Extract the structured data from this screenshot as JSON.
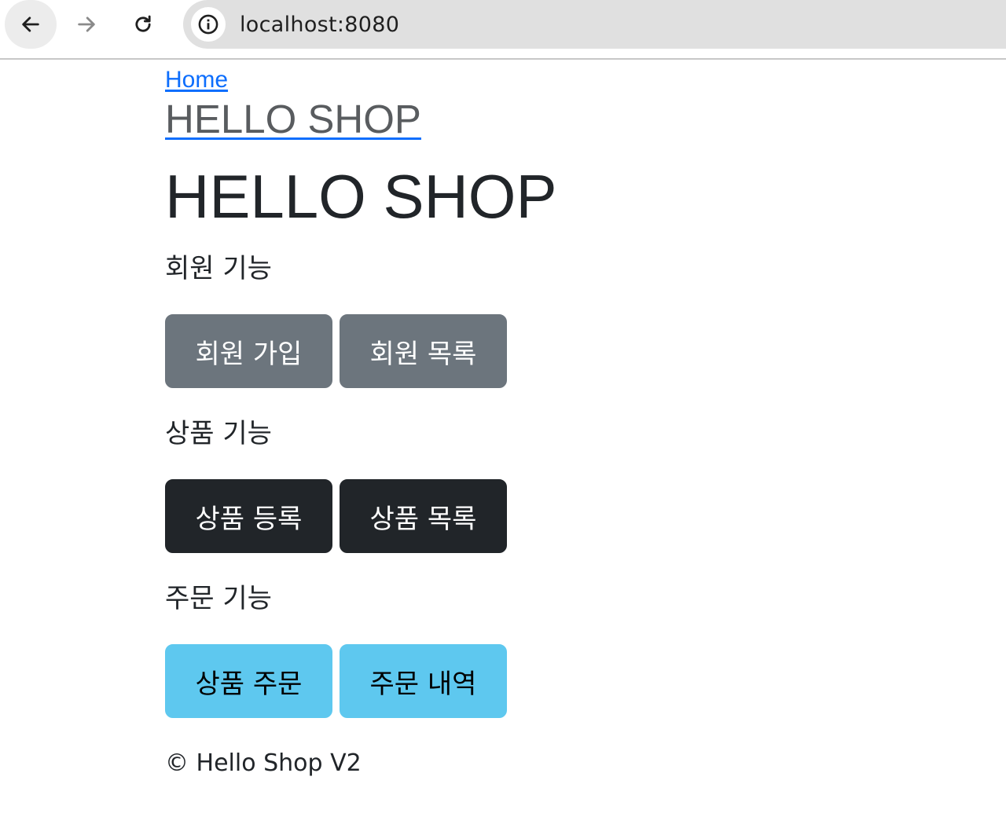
{
  "browser": {
    "url": "localhost:8080",
    "icons": {
      "back": "arrow-left-icon",
      "forward": "arrow-right-icon",
      "reload": "reload-icon",
      "site_info": "info-icon"
    }
  },
  "nav": {
    "home_link": "Home",
    "brand": "HELLO SHOP"
  },
  "page": {
    "title": "HELLO SHOP"
  },
  "sections": {
    "member": {
      "label": "회원 기능",
      "buttons": [
        "회원 가입",
        "회원 목록"
      ]
    },
    "item": {
      "label": "상품 기능",
      "buttons": [
        "상품 등록",
        "상품 목록"
      ]
    },
    "order": {
      "label": "주문 기능",
      "buttons": [
        "상품 주문",
        "주문 내역"
      ]
    }
  },
  "footer": {
    "text": "© Hello Shop V2"
  },
  "colors": {
    "link": "#0d6efd",
    "btn_secondary": "#6c757d",
    "btn_dark": "#212529",
    "btn_info": "#5ec8ef"
  }
}
